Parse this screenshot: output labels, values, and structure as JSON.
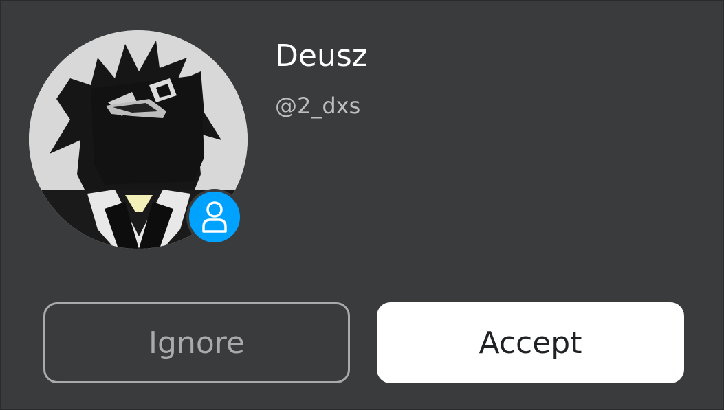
{
  "user": {
    "display_name": "Deusz",
    "username": "@2_dxs"
  },
  "avatar": {
    "icon": "user-avatar-image",
    "status_icon": "person-icon",
    "status_color": "#00a2ff"
  },
  "actions": {
    "ignore_label": "Ignore",
    "accept_label": "Accept"
  },
  "colors": {
    "background": "#393b3d",
    "accept_bg": "#ffffff",
    "ignore_border": "#a9aaab"
  }
}
